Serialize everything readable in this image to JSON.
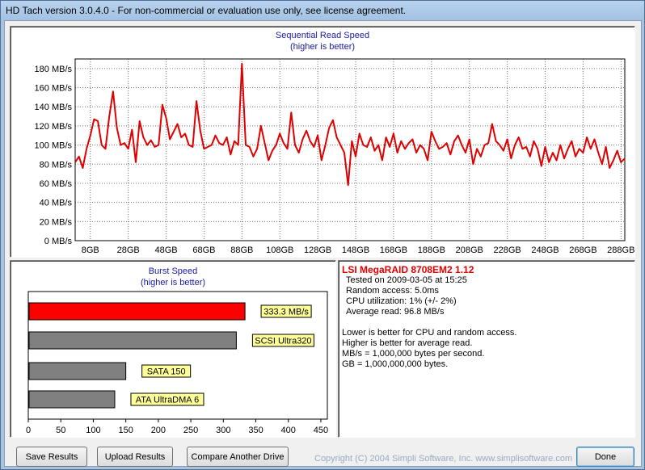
{
  "window": {
    "title": "HD Tach version 3.0.4.0  - For non-commercial or evaluation use only, see license agreement."
  },
  "read_chart": {
    "title": "Sequential Read Speed",
    "subtitle": "(higher is better)",
    "line_color": "#e00000"
  },
  "burst_chart": {
    "title": "Burst Speed",
    "subtitle": "(higher is better)",
    "highlight_color": "#ff0000",
    "bar_color": "#808080",
    "label_bg": "#ffff99"
  },
  "chart_data": [
    {
      "type": "line",
      "title": "Sequential Read Speed",
      "subtitle": "(higher is better)",
      "ylim": [
        0,
        190
      ],
      "y_ticks": [
        0,
        20,
        40,
        60,
        80,
        100,
        120,
        140,
        160,
        180
      ],
      "y_tick_labels": [
        "0 MB/s",
        "20 MB/s",
        "40 MB/s",
        "60 MB/s",
        "80 MB/s",
        "100 MB/s",
        "120 MB/s",
        "140 MB/s",
        "160 MB/s",
        "180 MB/s"
      ],
      "xlim": [
        0,
        290
      ],
      "x_ticks": [
        8,
        28,
        48,
        68,
        88,
        108,
        128,
        148,
        168,
        188,
        208,
        228,
        248,
        268,
        288
      ],
      "x_tick_labels": [
        "8GB",
        "28GB",
        "48GB",
        "68GB",
        "88GB",
        "108GB",
        "128GB",
        "148GB",
        "168GB",
        "188GB",
        "208GB",
        "228GB",
        "248GB",
        "268GB",
        "288GB"
      ],
      "grid": true,
      "series": [
        {
          "x": [
            0,
            2,
            4,
            6,
            8,
            10,
            12,
            14,
            16,
            18,
            20,
            22,
            24,
            26,
            28,
            30,
            32,
            34,
            36,
            38,
            40,
            42,
            44,
            46,
            48,
            50,
            52,
            54,
            56,
            58,
            60,
            62,
            64,
            66,
            68,
            70,
            72,
            74,
            76,
            78,
            80,
            82,
            84,
            86,
            88,
            90,
            92,
            94,
            96,
            98,
            100,
            102,
            104,
            106,
            108,
            110,
            112,
            114,
            116,
            118,
            120,
            122,
            124,
            126,
            128,
            130,
            132,
            134,
            136,
            138,
            140,
            142,
            144,
            146,
            148,
            150,
            152,
            154,
            156,
            158,
            160,
            162,
            164,
            166,
            168,
            170,
            172,
            174,
            176,
            178,
            180,
            182,
            184,
            186,
            188,
            190,
            192,
            194,
            196,
            198,
            200,
            202,
            204,
            206,
            208,
            210,
            212,
            214,
            216,
            218,
            220,
            222,
            224,
            226,
            228,
            230,
            232,
            234,
            236,
            238,
            240,
            242,
            244,
            246,
            248,
            250,
            252,
            254,
            256,
            258,
            260,
            262,
            264,
            266,
            268,
            270,
            272,
            274,
            276,
            278,
            280,
            282,
            284,
            286,
            288,
            290
          ],
          "y": [
            82,
            88,
            76,
            96,
            110,
            127,
            125,
            100,
            96,
            130,
            156,
            118,
            100,
            102,
            96,
            116,
            82,
            125,
            108,
            100,
            105,
            98,
            100,
            142,
            128,
            106,
            114,
            122,
            108,
            112,
            100,
            98,
            146,
            115,
            96,
            98,
            100,
            110,
            102,
            100,
            108,
            90,
            104,
            100,
            185,
            100,
            98,
            88,
            96,
            120,
            102,
            84,
            94,
            100,
            112,
            102,
            96,
            134,
            100,
            92,
            106,
            115,
            104,
            98,
            110,
            84,
            100,
            118,
            126,
            108,
            100,
            92,
            58,
            104,
            88,
            112,
            100,
            98,
            108,
            94,
            100,
            84,
            108,
            98,
            112,
            92,
            104,
            96,
            102,
            106,
            92,
            100,
            96,
            84,
            114,
            104,
            96,
            98,
            102,
            90,
            104,
            110,
            100,
            92,
            106,
            80,
            96,
            88,
            100,
            102,
            122,
            104,
            100,
            94,
            106,
            86,
            100,
            108,
            96,
            98,
            88,
            104,
            96,
            78,
            98,
            82,
            92,
            84,
            100,
            86,
            96,
            104,
            88,
            96,
            92,
            108,
            96,
            106,
            92,
            80,
            98,
            76,
            84,
            94,
            82,
            86
          ]
        }
      ]
    },
    {
      "type": "bar",
      "title": "Burst Speed",
      "subtitle": "(higher is better)",
      "orientation": "horizontal",
      "xlim": [
        0,
        460
      ],
      "x_ticks": [
        0,
        50,
        100,
        150,
        200,
        250,
        300,
        350,
        400,
        450
      ],
      "x_tick_labels": [
        "0",
        "50",
        "100",
        "150",
        "200",
        "250",
        "300",
        "350",
        "400",
        "450"
      ],
      "categories": [
        "333.3 MB/s",
        "SCSI Ultra320",
        "SATA 150",
        "ATA UltraDMA 6"
      ],
      "values": [
        333.3,
        320,
        150,
        133
      ]
    }
  ],
  "info": {
    "drive_name": "LSI MegaRAID  8708EM2 1.12",
    "lines": [
      "Tested on 2009-03-05 at 15:25",
      "Random access: 5.0ms",
      "CPU utilization: 1% (+/- 2%)",
      "Average read: 96.8 MB/s"
    ],
    "notes": [
      "Lower is better for CPU and random access.",
      "Higher is better for average read.",
      "MB/s = 1,000,000 bytes per second.",
      "GB = 1,000,000,000 bytes."
    ]
  },
  "buttons": {
    "save": "Save Results",
    "upload": "Upload Results",
    "compare": "Compare Another Drive",
    "done": "Done"
  },
  "footer": {
    "copyright": "Copyright (C) 2004 Simpli Software, Inc. www.simplisoftware.com"
  }
}
